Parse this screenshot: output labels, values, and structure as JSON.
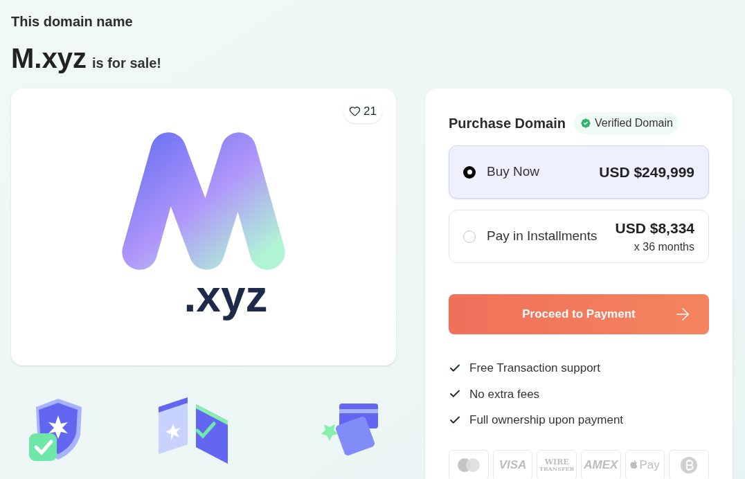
{
  "header": {
    "intro": "This domain name",
    "domain": "M.xyz",
    "suffix": "is for sale!"
  },
  "preview": {
    "likes": "21",
    "logo_text": ".xyz"
  },
  "illustrations": [
    {
      "kind": "shield"
    },
    {
      "kind": "windows"
    },
    {
      "kind": "cards"
    }
  ],
  "purchase": {
    "title": "Purchase Domain",
    "badge": "Verified Domain",
    "options": [
      {
        "label": "Buy Now",
        "price": "USD $249,999",
        "selected": true
      },
      {
        "label": "Pay in Installments",
        "price": "USD $8,334",
        "note": "x 36 months",
        "selected": false
      }
    ],
    "button": "Proceed to Payment",
    "features": [
      "Free Transaction support",
      "No extra fees",
      "Full ownership upon payment"
    ],
    "payment_methods": [
      {
        "kind": "mastercard"
      },
      {
        "kind": "text",
        "label": "VISA"
      },
      {
        "kind": "wire",
        "label": "WIRE",
        "sub": "TRANSFER"
      },
      {
        "kind": "text",
        "label": "AMEX"
      },
      {
        "kind": "apple",
        "label": "Pay"
      },
      {
        "kind": "bitcoin"
      }
    ]
  }
}
